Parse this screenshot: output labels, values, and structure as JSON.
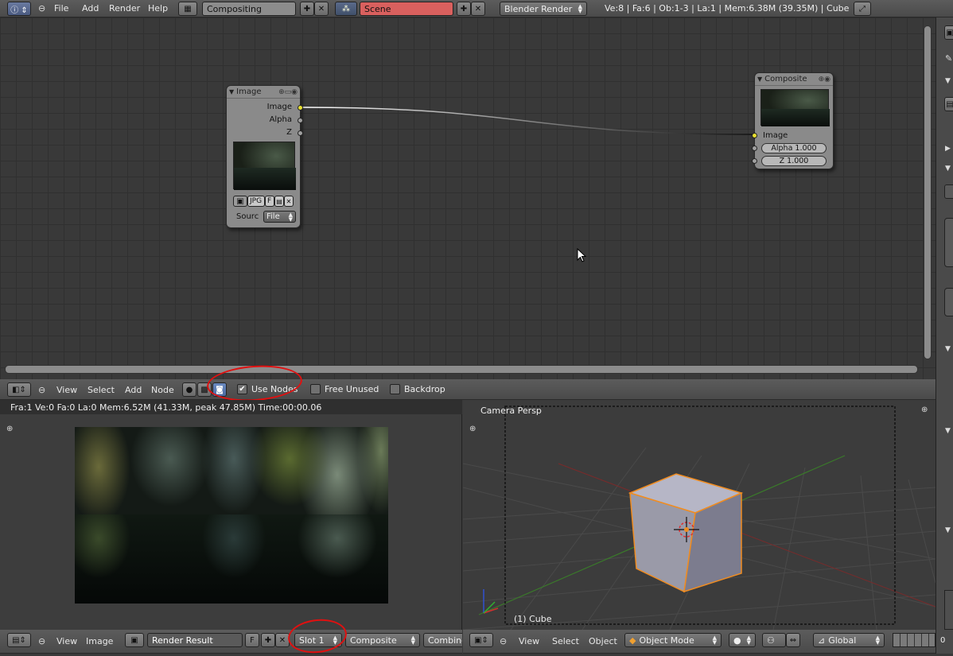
{
  "top_header": {
    "menus": [
      "File",
      "Add",
      "Render",
      "Help"
    ],
    "screen_layout": "Compositing",
    "scene": "Scene",
    "render_engine": "Blender Render",
    "stats": "Ve:8 | Fa:6 | Ob:1-3 | La:1 | Mem:6.38M (39.35M) | Cube"
  },
  "node_editor": {
    "image_node": {
      "title": "Image",
      "outputs": [
        "Image",
        "Alpha",
        "Z"
      ],
      "format_label": "JPG",
      "frame_label": "F",
      "source_label": "Sourc",
      "source_value": "File"
    },
    "composite_node": {
      "title": "Composite",
      "input_image": "Image",
      "alpha_field": "Alpha 1.000",
      "z_field": "Z 1.000"
    },
    "header": {
      "menus": [
        "View",
        "Select",
        "Add",
        "Node"
      ],
      "use_nodes_label": "Use Nodes",
      "use_nodes_checked": true,
      "free_unused_label": "Free Unused",
      "backdrop_label": "Backdrop"
    }
  },
  "image_editor": {
    "info": "Fra:1  Ve:0 Fa:0 La:0 Mem:6.52M (41.33M, peak 47.85M) Time:00:00.06",
    "header": {
      "menus": [
        "View",
        "Image"
      ],
      "image_name": "Render Result",
      "fake_user": "F",
      "slot": "Slot 1",
      "layer": "Composite",
      "pass": "Combined"
    }
  },
  "viewport": {
    "view_name": "Camera Persp",
    "object_label": "(1) Cube",
    "header": {
      "menus": [
        "View",
        "Select",
        "Object"
      ],
      "mode": "Object Mode",
      "orientation": "Global"
    }
  },
  "properties": {
    "field_value": "0"
  },
  "colors": {
    "scene_field": "#d9605e",
    "socket_yellow": "#e8e030",
    "annotation_red": "#e01010",
    "cube_outline": "#f08c20"
  }
}
